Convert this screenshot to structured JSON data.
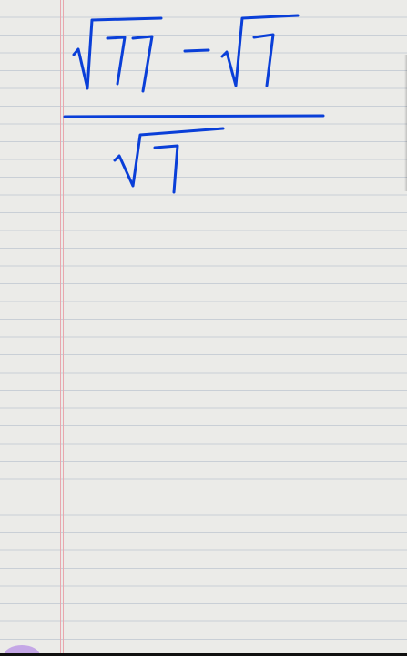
{
  "notebook": {
    "ink_color": "#0a3fd8",
    "paper_color": "#ebebe8",
    "rule_color": "#c9cfd6",
    "margin_color": "#e8a7ae"
  },
  "expression": {
    "numerator": {
      "term1_radicand": "77",
      "operator": "−",
      "term2_radicand": "7"
    },
    "denominator": {
      "radicand": "7"
    }
  }
}
